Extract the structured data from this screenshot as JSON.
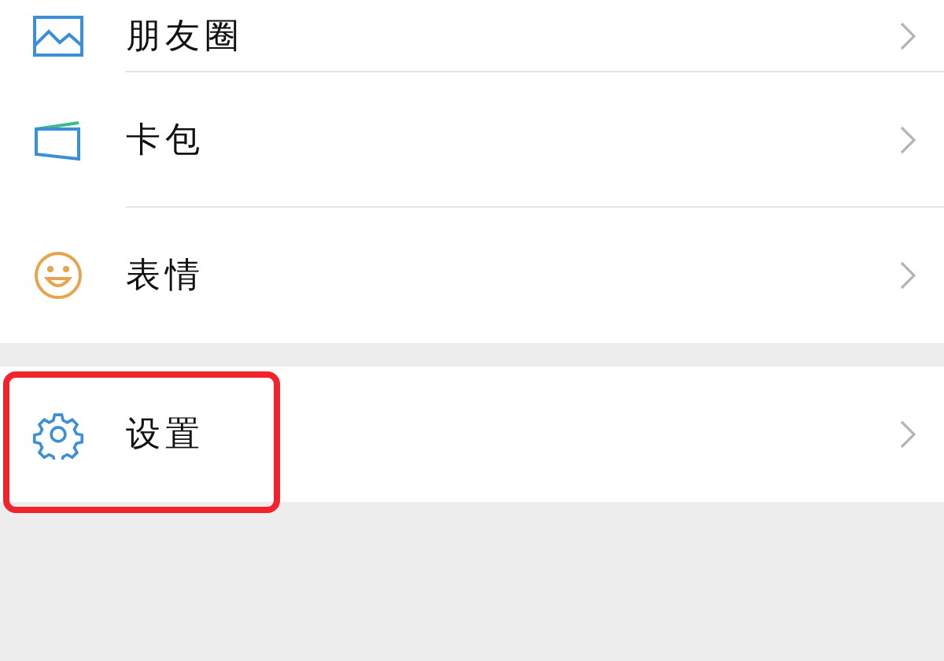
{
  "groups": [
    {
      "items": [
        {
          "label": "朋友圈",
          "kind": "picture",
          "highlighted": false
        },
        {
          "label": "卡包",
          "kind": "card",
          "highlighted": false
        },
        {
          "label": "表情",
          "kind": "smiley",
          "highlighted": false
        }
      ]
    },
    {
      "items": [
        {
          "label": "设置",
          "kind": "gear",
          "highlighted": true
        }
      ]
    }
  ]
}
